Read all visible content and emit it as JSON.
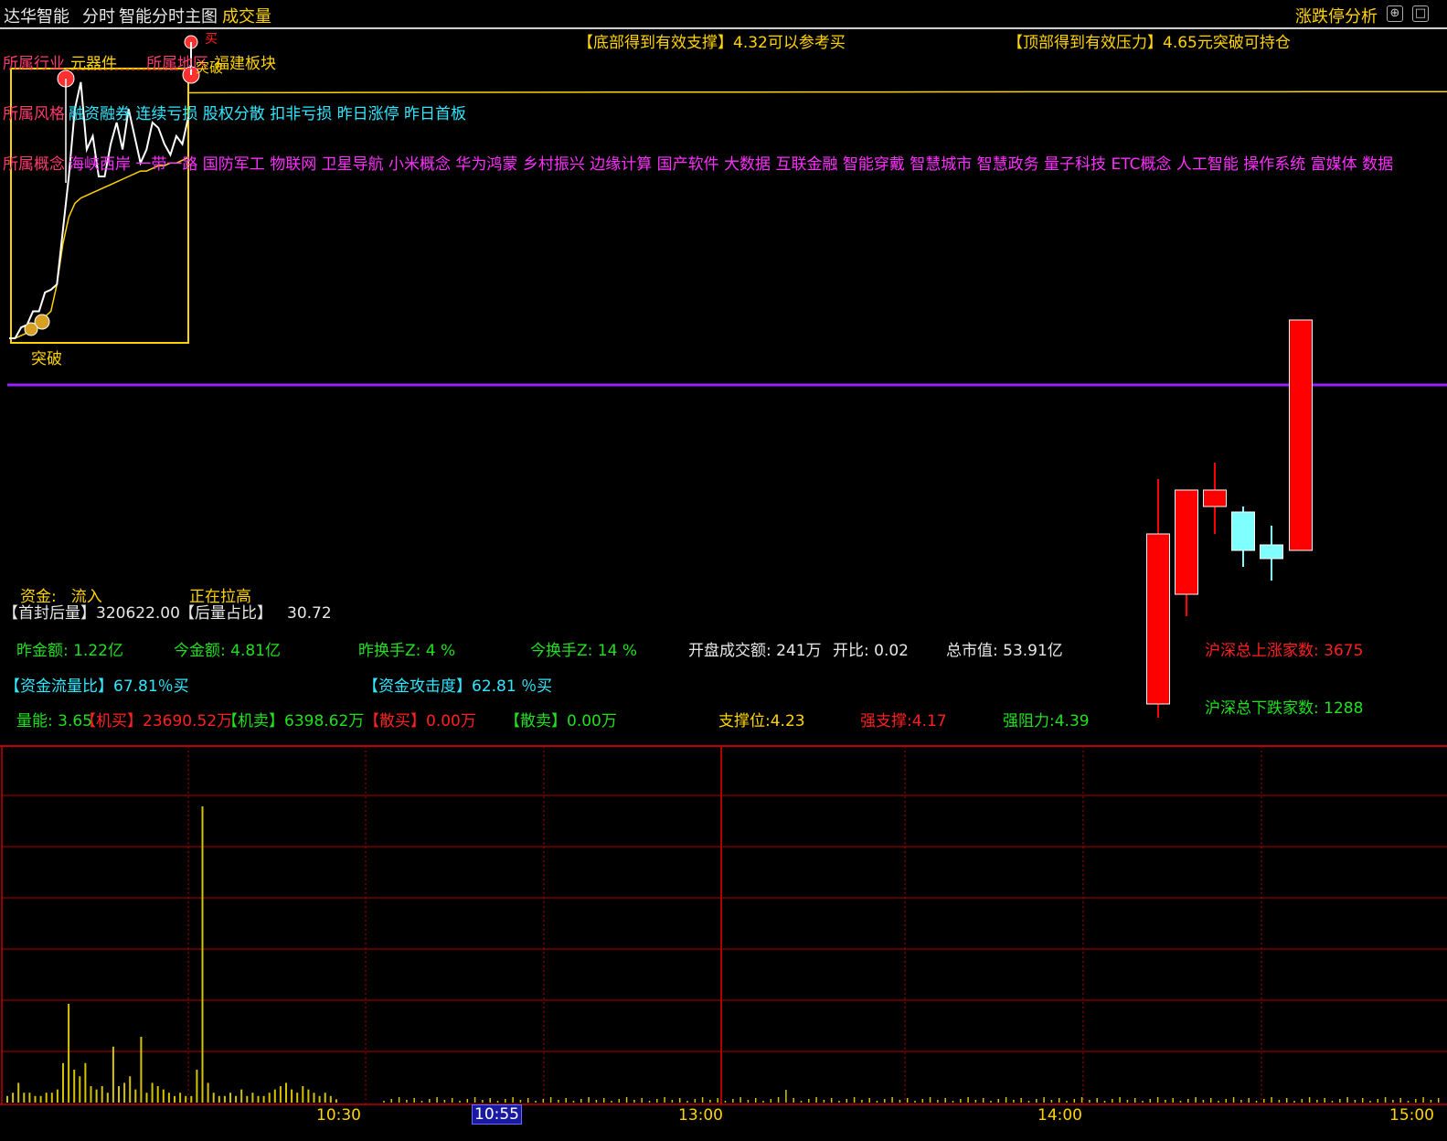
{
  "titlebar": {
    "app": "达华智能",
    "tab1": "分时",
    "tab2": "智能分时主图",
    "tab3": "成交量",
    "right": "涨跌停分析",
    "btn1": "⊕",
    "btn2": "□"
  },
  "banner": {
    "support_title": "【底部得到有效支撑】",
    "support_text": "4.32可以参考买",
    "pressure_title": "【顶部得到有效压力】",
    "pressure_text": "4.65元突破可持仓"
  },
  "tags": {
    "industry_label": "所属行业",
    "industry_value": "元器件",
    "region_label": "所属地区",
    "region_value": "福建板块",
    "style_label": "所属风格",
    "style_value": "融资融券 连续亏损 股权分散 扣非亏损 昨日涨停 昨日首板",
    "concept_label": "所属概念",
    "concept_value": "海峡西岸 一带一路 国防军工 物联网 卫星导航 小米概念 华为鸿蒙 乡村振兴 边缘计算 国产软件 大数据 互联金融 智能穿戴 智慧城市 智慧政务 量子科技 ETC概念 人工智能 操作系统 富媒体 数据"
  },
  "markers": {
    "breakout_bottom": "突破",
    "breakout_top": "突破",
    "buy_mark": "买"
  },
  "stats": {
    "fund_label": "资金:",
    "fund_value": "流入",
    "status": "正在拉高",
    "first_seal_label": "【首封后量】",
    "first_seal_value": "320622.00",
    "after_ratio_label": "【后量占比】",
    "after_ratio_value": "30.72",
    "prev_amount": "昨金额: 1.22亿",
    "today_amount": "今金额: 4.81亿",
    "prev_turnover": "昨换手Z: 4 %",
    "today_turnover": "今换手Z: 14 %",
    "open_amount": "开盘成交额: 241万",
    "open_ratio": "开比: 0.02",
    "market_cap": "总市值: 53.91亿",
    "up_count": "沪深总上涨家数: 3675",
    "down_count": "沪深总下跌家数: 1288",
    "flow_ratio_label": "【资金流量比】",
    "flow_ratio_value": "67.81％买",
    "attack_label": "【资金攻击度】",
    "attack_value": "62.81 ％买",
    "vol_energy": "量能: 3.65",
    "inst_buy_label": "【机买】",
    "inst_buy_value": "23690.52万",
    "inst_sell_label": "【机卖】",
    "inst_sell_value": "6398.62万",
    "retail_buy_label": "【散买】",
    "retail_buy_value": "0.00万",
    "retail_sell_label": "【散卖】",
    "retail_sell_value": "0.00万",
    "support": "支撑位:4.23",
    "strong_support": "强支撑:4.17",
    "strong_resist": "强阻力:4.39"
  },
  "axis": {
    "ticks": [
      "10:30",
      "10:55",
      "13:00",
      "14:00",
      "15:00"
    ],
    "cursor_index": 1
  },
  "colors": {
    "price_line": "#ffffff",
    "avg_line": "#ffd400",
    "divider": "#9a20ff",
    "grid": "#b00000",
    "candle_up": "#ff0000",
    "candle_down": "#80ffff",
    "volume": "#d4c400"
  },
  "chart_data": {
    "type": "line",
    "price_series": [
      0.0,
      0.0,
      0.04,
      0.05,
      0.1,
      0.1,
      0.17,
      0.18,
      0.2,
      0.4,
      0.6,
      0.85,
      0.95,
      0.7,
      0.75,
      0.6,
      0.6,
      0.72,
      0.8,
      0.7,
      0.85,
      0.75,
      0.65,
      0.7,
      0.8,
      0.78,
      0.72,
      0.68,
      0.75,
      0.72,
      0.82
    ],
    "avg_series": [
      0.0,
      0.0,
      0.01,
      0.02,
      0.04,
      0.06,
      0.08,
      0.1,
      0.2,
      0.35,
      0.45,
      0.5,
      0.52,
      0.53,
      0.54,
      0.55,
      0.56,
      0.57,
      0.58,
      0.59,
      0.6,
      0.61,
      0.62,
      0.62,
      0.63,
      0.64,
      0.64,
      0.65,
      0.65,
      0.66,
      0.67
    ],
    "avg_long": [
      0.7,
      0.705,
      0.71,
      0.712,
      0.715,
      0.717,
      0.72,
      0.72,
      0.721,
      0.722
    ],
    "candles": [
      {
        "o": 0.1,
        "c": 0.72,
        "h": 0.92,
        "l": 0.05,
        "up": true
      },
      {
        "o": 0.5,
        "c": 0.88,
        "h": 0.88,
        "l": 0.42,
        "up": true
      },
      {
        "o": 0.88,
        "c": 0.82,
        "h": 0.98,
        "l": 0.72,
        "up": true
      },
      {
        "o": 0.8,
        "c": 0.66,
        "h": 0.82,
        "l": 0.6,
        "up": false
      },
      {
        "o": 0.68,
        "c": 0.63,
        "h": 0.75,
        "l": 0.55,
        "up": false
      },
      {
        "o": 0.66,
        "c": 1.5,
        "h": 1.5,
        "l": 0.66,
        "up": true
      }
    ],
    "volume": [
      0.02,
      0.03,
      0.06,
      0.03,
      0.03,
      0.02,
      0.02,
      0.03,
      0.03,
      0.04,
      0.12,
      0.3,
      0.1,
      0.08,
      0.12,
      0.05,
      0.04,
      0.05,
      0.03,
      0.17,
      0.05,
      0.06,
      0.08,
      0.04,
      0.2,
      0.03,
      0.06,
      0.05,
      0.04,
      0.03,
      0.02,
      0.03,
      0.02,
      0.02,
      0.1,
      0.9,
      0.06,
      0.03,
      0.02,
      0.02,
      0.03,
      0.02,
      0.04,
      0.02,
      0.03,
      0.02,
      0.02,
      0.03,
      0.04,
      0.05,
      0.06,
      0.04,
      0.03,
      0.05,
      0.04,
      0.03,
      0.02,
      0.03,
      0.02,
      0.01
    ]
  }
}
